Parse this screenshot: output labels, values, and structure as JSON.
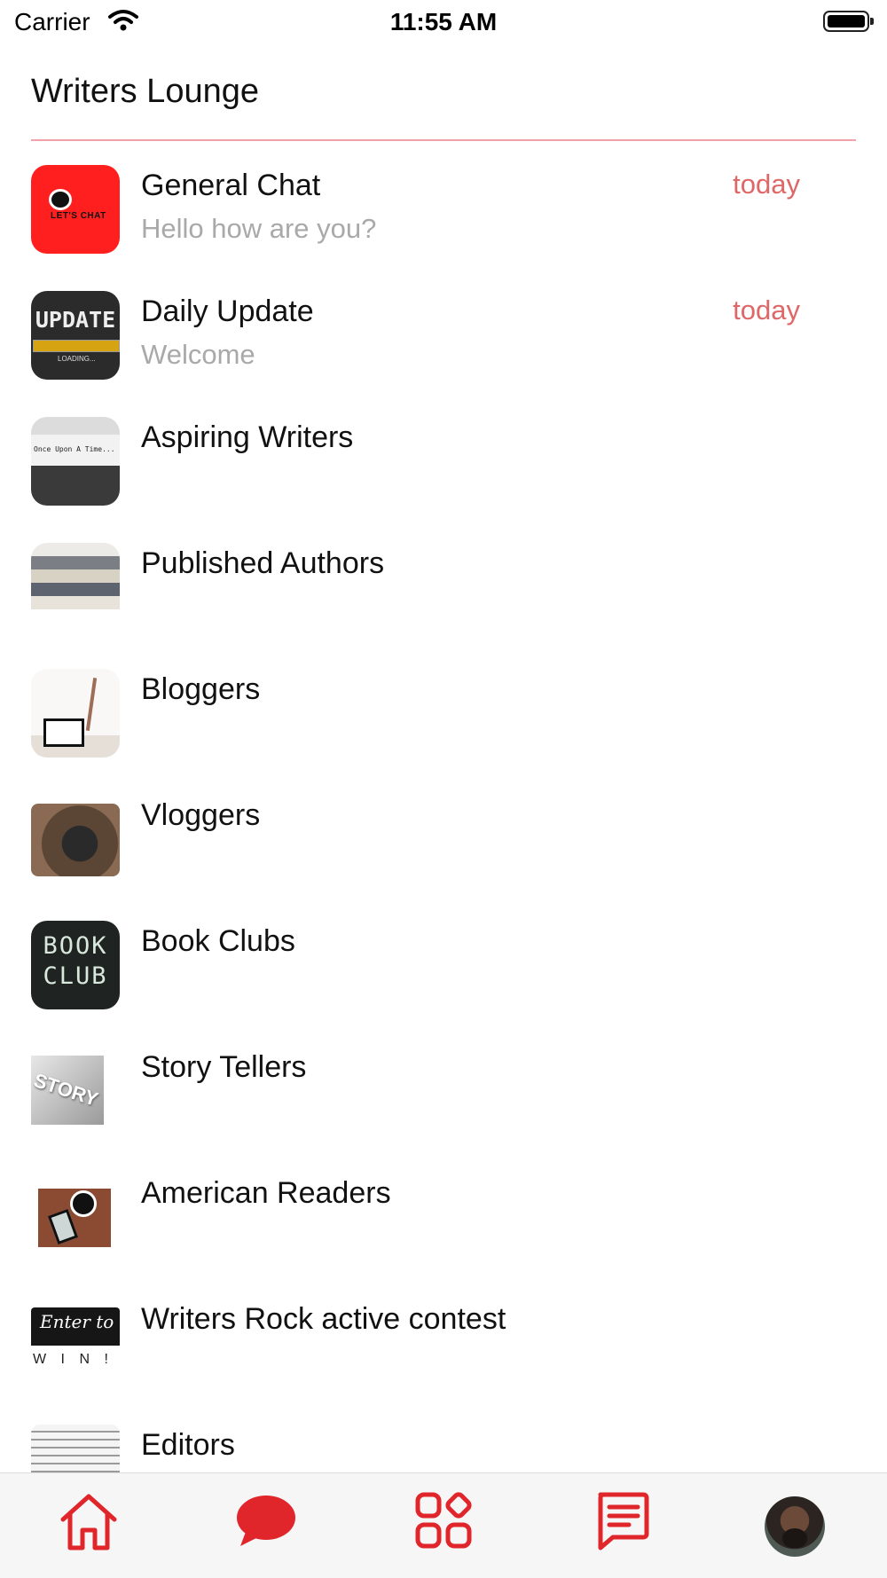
{
  "status_bar": {
    "carrier": "Carrier",
    "time": "11:55 AM"
  },
  "header": {
    "title": "Writers Lounge"
  },
  "chats": [
    {
      "name": "General Chat",
      "preview": "Hello how are you?",
      "time": "today",
      "thumb_text": "LET'S CHAT"
    },
    {
      "name": "Daily Update",
      "preview": "Welcome",
      "time": "today",
      "thumb_text": "UPDATE",
      "thumb_subtext": "LOADING..."
    },
    {
      "name": "Aspiring Writers",
      "preview": "",
      "time": "",
      "thumb_text": "Once Upon A Time..."
    },
    {
      "name": "Published Authors",
      "preview": "",
      "time": ""
    },
    {
      "name": "Bloggers",
      "preview": "",
      "time": ""
    },
    {
      "name": "Vloggers",
      "preview": "",
      "time": ""
    },
    {
      "name": "Book Clubs",
      "preview": "",
      "time": "",
      "thumb_text": "BOOK CLUB"
    },
    {
      "name": "Story Tellers",
      "preview": "",
      "time": "",
      "thumb_text": "STORY"
    },
    {
      "name": "American Readers",
      "preview": "",
      "time": ""
    },
    {
      "name": "Writers Rock active contest",
      "preview": "",
      "time": "",
      "thumb_text": "Enter to",
      "thumb_subtext": "W I N !"
    },
    {
      "name": "Editors",
      "preview": "",
      "time": ""
    }
  ],
  "tab_bar": {
    "tabs": [
      "home-icon",
      "chat-bubble-icon",
      "apps-grid-icon",
      "message-list-icon",
      "profile-avatar"
    ],
    "active": "chat-bubble-icon"
  },
  "colors": {
    "accent": "#e0262b",
    "divider": "#f3a0a8",
    "time_text": "#e06767",
    "preview_text": "#a9a9a9"
  }
}
